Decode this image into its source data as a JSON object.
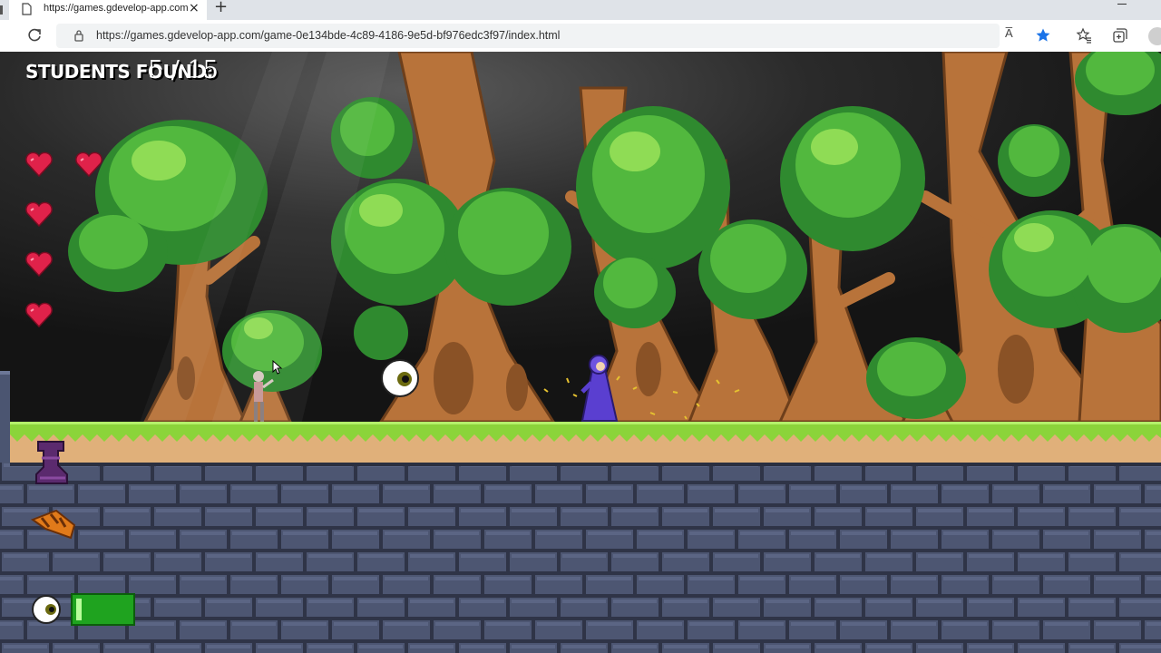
{
  "browser": {
    "tab_title": "https://games.gdevelop-app.com",
    "tab_close": "×",
    "new_tab": "+",
    "url": "https://games.gdevelop-app.com/game-0e134bde-4c89-4186-9e5d-bf976edc3f97/index.html",
    "read_aloud": "A̅",
    "icons": [
      "page-icon",
      "reload-icon",
      "lock-icon",
      "read-aloud-icon",
      "favorite-star-icon",
      "favorites-icon",
      "collections-icon",
      "profile-icon"
    ],
    "accent_color": "#1a73e8"
  },
  "game": {
    "hud": {
      "label": "STUDENTS FOUND:",
      "found": "5 / 15",
      "lives": 5,
      "eye_energy": 0.1
    },
    "colors": {
      "grass": "#8bd43a",
      "dirt": "#e0b07a",
      "brick": "#4b5571",
      "heart": "#e0224a",
      "meter": "#1fa31f"
    },
    "sprites": [
      "player-wizard",
      "student-npc",
      "floating-eye",
      "boots-item",
      "shoes-item",
      "eye-item"
    ]
  }
}
